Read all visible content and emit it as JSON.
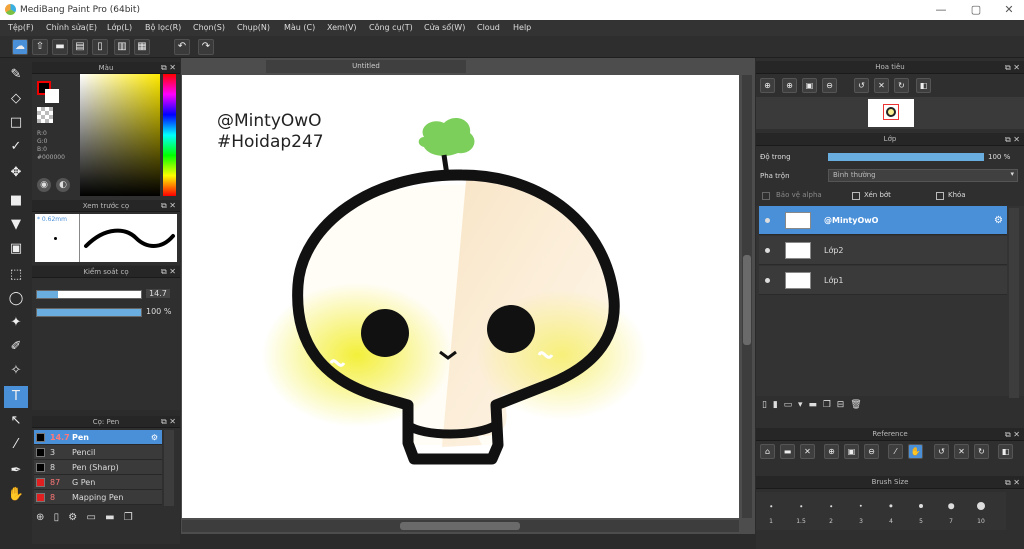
{
  "window": {
    "title": "MediBang Paint Pro (64bit)",
    "min": "—",
    "max": "▢",
    "close": "✕"
  },
  "menu": [
    "Tệp(F)",
    "Chỉnh sửa(E)",
    "Lớp(L)",
    "Bộ lọc(R)",
    "Chọn(S)",
    "Chụp(N)",
    "Màu (C)",
    "Xem(V)",
    "Công cụ(T)",
    "Cửa sổ(W)",
    "Cloud",
    "Help"
  ],
  "color_panel": {
    "title": "Màu",
    "r": "R:0",
    "g": "G:0",
    "b": "B:0",
    "hex": "#000000"
  },
  "preview_panel": {
    "title": "Xem trước cọ",
    "size": "* 0.62mm"
  },
  "control_panel": {
    "title": "Kiểm soát cọ",
    "size_value": "14.7",
    "size_fill": 0.2,
    "opacity_value": "100 %",
    "opacity_fill": 1.0
  },
  "brush_panel": {
    "title": "Cọ: Pen",
    "brushes": [
      {
        "size": "14.7",
        "name": "Pen",
        "color": "#000000",
        "selected": true
      },
      {
        "size": "3",
        "name": "Pencil",
        "color": "#000000",
        "selected": false
      },
      {
        "size": "8",
        "name": "Pen (Sharp)",
        "color": "#000000",
        "selected": false
      },
      {
        "size": "87",
        "name": "G Pen",
        "color": "#e02020",
        "selected": false
      },
      {
        "size": "8",
        "name": "Mapping Pen",
        "color": "#e02020",
        "selected": false
      }
    ]
  },
  "document": {
    "tab": "Untitled",
    "signature_line1": "@MintyOwO",
    "signature_line2": "#Hoidap247"
  },
  "navigator": {
    "title": "Hoa tiêu"
  },
  "layers": {
    "title": "Lớp",
    "opacity_label": "Độ trong",
    "opacity_value": "100 %",
    "opacity_fill": 1.0,
    "blend_label": "Pha trộn",
    "blend_value": "Bình thường",
    "protect_alpha": "Bảo vệ alpha",
    "clipping": "Xén bớt",
    "lock": "Khóa",
    "items": [
      {
        "name": "@MintyOwO",
        "selected": true
      },
      {
        "name": "Lớp2",
        "selected": false
      },
      {
        "name": "Lớp1",
        "selected": false
      }
    ]
  },
  "reference": {
    "title": "Reference"
  },
  "brush_size": {
    "title": "Brush Size",
    "sizes": [
      "1",
      "1.5",
      "2",
      "3",
      "4",
      "5",
      "7",
      "10"
    ]
  }
}
